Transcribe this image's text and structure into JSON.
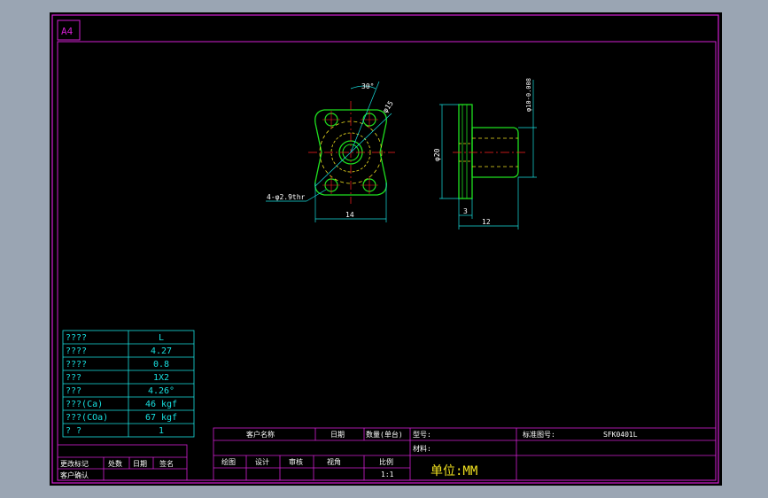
{
  "sheet": {
    "size_label": "A4"
  },
  "colors": {
    "frame": "#d21fd2",
    "green": "#1fe01f",
    "cyan": "#18e0e0",
    "yellow": "#f0e020",
    "white": "#ffffff",
    "red": "#ff2020",
    "bg": "#000000",
    "outer": "#9aa5b3"
  },
  "drawing": {
    "front_view": {
      "angle_dim": "30°",
      "dia_dim": "φ15",
      "hole_note": "4-φ2.9thr",
      "width_dim": "14"
    },
    "side_view": {
      "flange_dia": "φ20",
      "bore_dia": "φ10-0.008",
      "flange_thk": "3",
      "length": "12"
    }
  },
  "spec_table": {
    "rows": [
      {
        "label": "????",
        "value": "L"
      },
      {
        "label": "????",
        "value": "4.27"
      },
      {
        "label": "????",
        "value": "0.8"
      },
      {
        "label": "???",
        "value": "1X2"
      },
      {
        "label": "???",
        "value": "4.26°"
      },
      {
        "label": "???(Ca)",
        "value": "46 kgf"
      },
      {
        "label": "???(COa)",
        "value": "67 kgf"
      },
      {
        "label": "?  ?",
        "value": "1"
      }
    ]
  },
  "revision_block": {
    "headers": [
      "更改标记",
      "处数",
      "日期",
      "签名"
    ],
    "confirm": "客户确认"
  },
  "title_block": {
    "customer_name": "客户名称",
    "date": "日期",
    "quantity": "数量(单台)",
    "model": "型号:",
    "material": "材料:",
    "standard_no": "标准图号:",
    "drawing_no": "SFK0401L",
    "drafter": "绘图",
    "checker": "设计",
    "approver": "审核",
    "viewing": "视角",
    "scale": "比例",
    "scale_value": "1:1",
    "unit": "单位:MM"
  }
}
